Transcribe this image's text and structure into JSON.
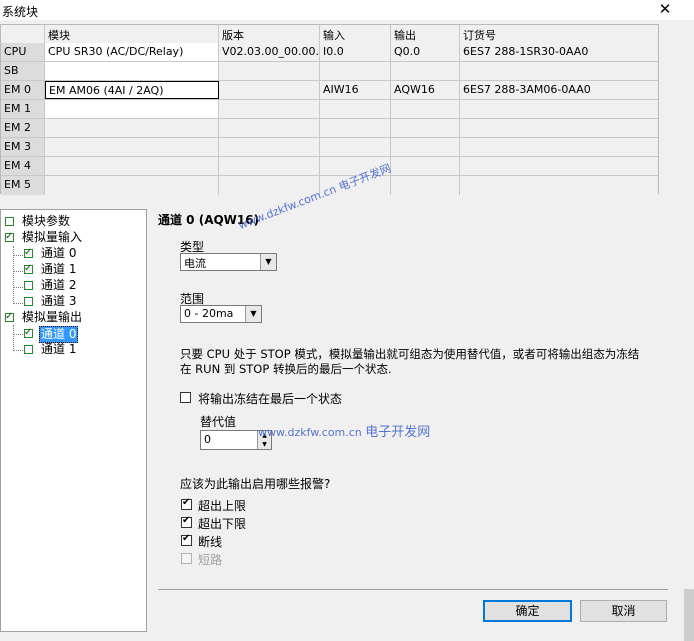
{
  "window": {
    "title": "系统块",
    "close_glyph": "✕"
  },
  "module_table": {
    "headers": [
      "",
      "模块",
      "版本",
      "输入",
      "输出",
      "订货号"
    ],
    "rows": [
      {
        "slot": "CPU",
        "module": "CPU SR30 (AC/DC/Relay)",
        "version": "V02.03.00_00.00...",
        "input": "I0.0",
        "output": "Q0.0",
        "order": "6ES7 288-1SR30-0AA0"
      },
      {
        "slot": "SB",
        "module": "",
        "version": "",
        "input": "",
        "output": "",
        "order": ""
      },
      {
        "slot": "EM 0",
        "module": "EM AM06 (4AI / 2AQ)",
        "version": "",
        "input": "AIW16",
        "output": "AQW16",
        "order": "6ES7 288-3AM06-0AA0"
      },
      {
        "slot": "EM 1",
        "module": "",
        "version": "",
        "input": "",
        "output": "",
        "order": ""
      },
      {
        "slot": "EM 2",
        "module": "",
        "version": "",
        "input": "",
        "output": "",
        "order": ""
      },
      {
        "slot": "EM 3",
        "module": "",
        "version": "",
        "input": "",
        "output": "",
        "order": ""
      },
      {
        "slot": "EM 4",
        "module": "",
        "version": "",
        "input": "",
        "output": "",
        "order": ""
      },
      {
        "slot": "EM 5",
        "module": "",
        "version": "",
        "input": "",
        "output": "",
        "order": ""
      }
    ]
  },
  "tree": {
    "items": [
      {
        "label": "模块参数"
      },
      {
        "label": "模拟量输入"
      },
      {
        "label": "通道 0"
      },
      {
        "label": "通道 1"
      },
      {
        "label": "通道 2"
      },
      {
        "label": "通道 3"
      },
      {
        "label": "模拟量输出"
      },
      {
        "label": "通道 0"
      },
      {
        "label": "通道 1"
      }
    ]
  },
  "panel": {
    "title": "通道 0 (AQW16)",
    "type_label": "类型",
    "type_value": "电流",
    "range_label": "范围",
    "range_value": "0 - 20ma",
    "description": "只要 CPU 处于 STOP 模式，模拟量输出就可组态为使用替代值，或者可将输出组态为冻结在 RUN 到 STOP 转换后的最后一个状态.",
    "freeze_label": "将输出冻结在最后一个状态",
    "freeze_checked": false,
    "substitute_label": "替代值",
    "substitute_value": "0",
    "alarms_question": "应该为此输出启用哪些报警?",
    "alarms": [
      {
        "label": "超出上限",
        "checked": true,
        "enabled": true
      },
      {
        "label": "超出下限",
        "checked": true,
        "enabled": true
      },
      {
        "label": "断线",
        "checked": true,
        "enabled": true
      },
      {
        "label": "短路",
        "checked": false,
        "enabled": false
      }
    ]
  },
  "buttons": {
    "ok": "确定",
    "cancel": "取消"
  },
  "watermarks": {
    "w1": "www.dzkfw.com.cn 电子开发网",
    "w2_url": "www.dzkfw.com.cn",
    "w2_cn": "电子开发网"
  }
}
